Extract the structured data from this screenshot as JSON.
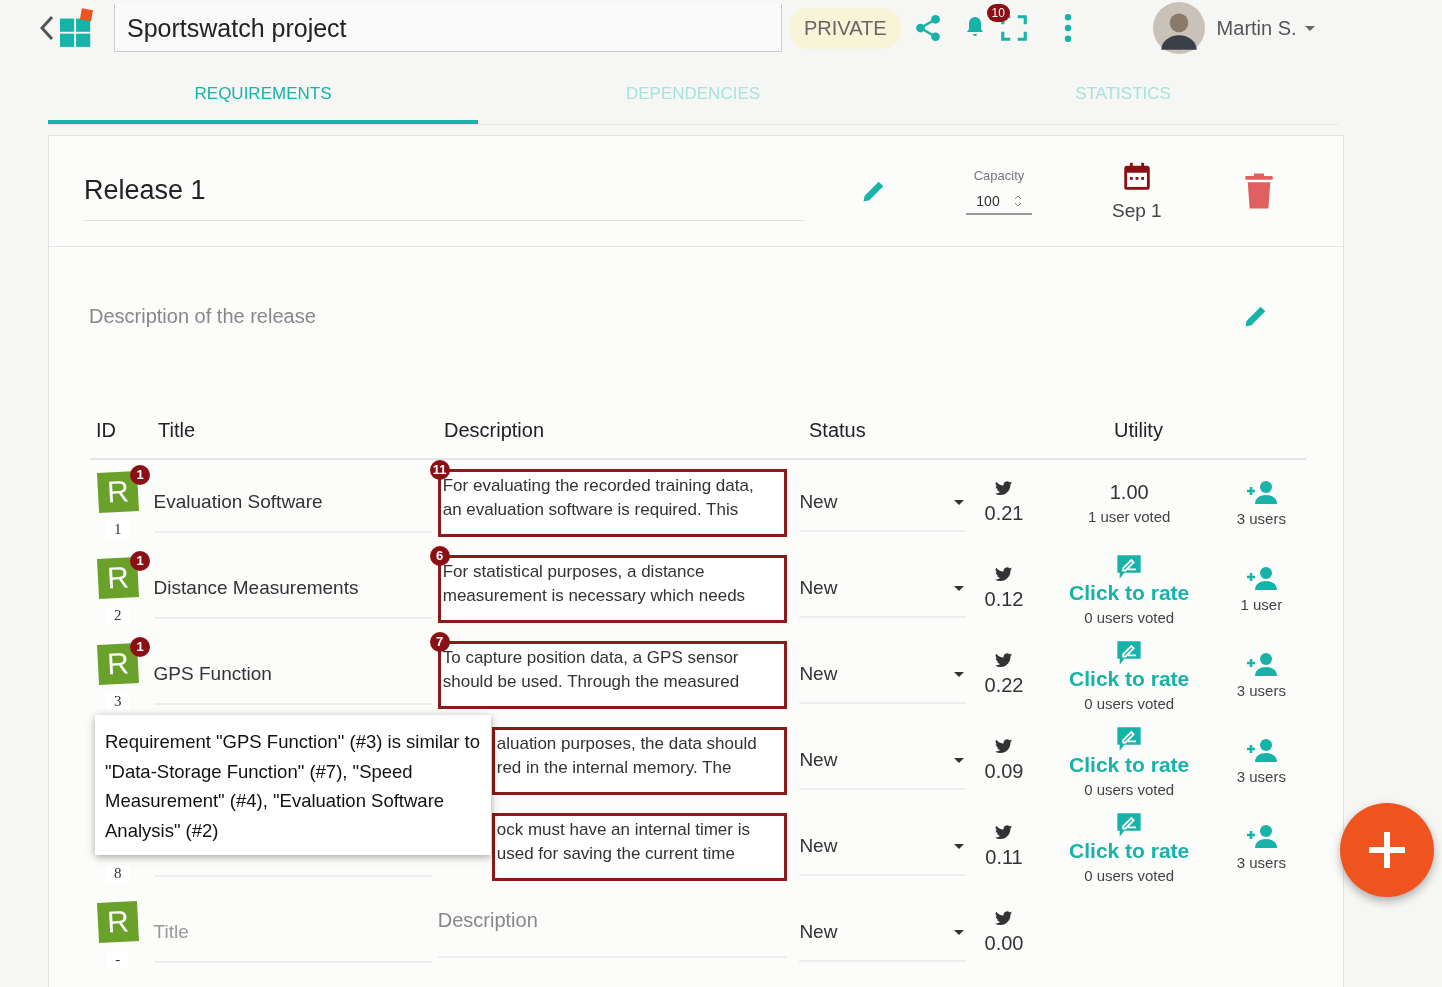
{
  "header": {
    "project_title": "Sportswatch project",
    "visibility": "PRIVATE",
    "notifications": "10",
    "user": "Martin S."
  },
  "tabs": [
    {
      "label": "REQUIREMENTS",
      "selected": true
    },
    {
      "label": "DEPENDENCIES",
      "selected": false
    },
    {
      "label": "STATISTICS",
      "selected": false
    }
  ],
  "release": {
    "title": "Release 1",
    "capacity_label": "Capacity",
    "capacity": "100",
    "date": "Sep 1",
    "description_placeholder": "Description of the release"
  },
  "table": {
    "columns": [
      "ID",
      "Title",
      "Description",
      "Status",
      "Utility"
    ],
    "rows": [
      {
        "kind": "rated",
        "tile": "R",
        "id": "1",
        "similar": "1",
        "title": "Evaluation Software",
        "desc_count": "11",
        "description": "For evaluating the recorded training data, an evaluation software is required. This",
        "covered": false,
        "status": "New",
        "score": "0.21",
        "utility": "1.00",
        "voted": "1 user voted",
        "users": "3 users"
      },
      {
        "kind": "unrated",
        "tile": "R",
        "id": "2",
        "similar": "1",
        "title": "Distance Measurements",
        "desc_count": "6",
        "description": "For statistical purposes, a distance measurement is necessary which needs",
        "covered": false,
        "status": "New",
        "score": "0.12",
        "utility": "Click to rate",
        "voted": "0 users voted",
        "users": "1 user"
      },
      {
        "kind": "unrated",
        "tile": "R",
        "id": "3",
        "similar": "1",
        "title": "GPS Function",
        "desc_count": "7",
        "description": "To capture position data, a GPS sensor should be used. Through the measured",
        "covered": false,
        "status": "New",
        "score": "0.22",
        "utility": "Click to rate",
        "voted": "0 users voted",
        "users": "3 users"
      },
      {
        "kind": "unrated",
        "description": "aluation purposes, the data should red in the internal memory. The",
        "covered": true,
        "status": "New",
        "score": "0.09",
        "utility": "Click to rate",
        "voted": "0 users voted",
        "users": "3 users"
      },
      {
        "kind": "unrated",
        "id": "8",
        "description": "ock must have an internal timer is used for saving the current time",
        "covered": true,
        "status": "New",
        "score": "0.11",
        "utility": "Click to rate",
        "voted": "0 users voted",
        "users": "3 users"
      },
      {
        "kind": "new",
        "tile": "R",
        "id": "-",
        "title_placeholder": "Title",
        "description_placeholder": "Description",
        "status": "New",
        "score": "0.00"
      }
    ]
  },
  "tooltip": {
    "text": "Requirement \"GPS Function\" (#3) is similar to \"Data-Storage Function\" (#7), \"Speed Measurement\" (#4), \"Evaluation Software Analysis\" (#2)"
  }
}
